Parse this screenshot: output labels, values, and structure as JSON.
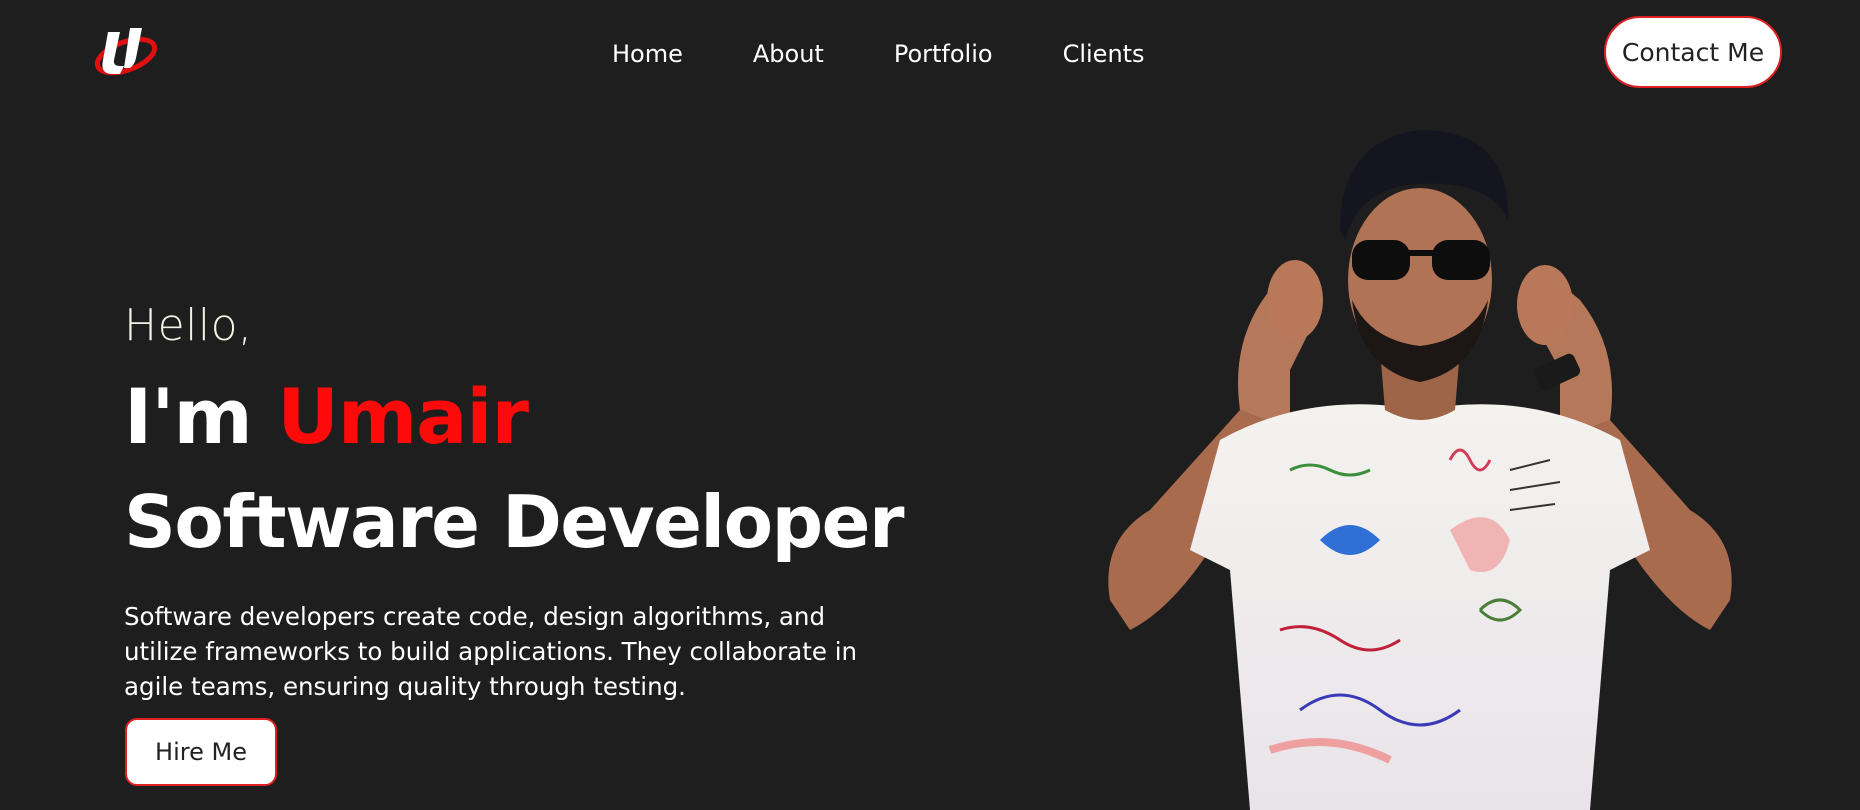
{
  "header": {
    "logo_icon": "umair-logo-icon",
    "nav": [
      {
        "label": "Home"
      },
      {
        "label": "About"
      },
      {
        "label": "Portfolio"
      },
      {
        "label": "Clients"
      }
    ],
    "contact_label": "Contact Me"
  },
  "hero": {
    "greeting": "Hello,",
    "intro_prefix": "I'm",
    "name": "Umair",
    "role": "Software Developer",
    "description": "Software developers create code, design algorithms, and utilize frameworks to build applications. They collaborate in agile teams, ensuring quality through testing.",
    "hire_label": "Hire Me",
    "photo": "developer-portrait"
  },
  "colors": {
    "background": "#1e1e1e",
    "accent": "#ff0a0a",
    "text": "#ffffff"
  }
}
